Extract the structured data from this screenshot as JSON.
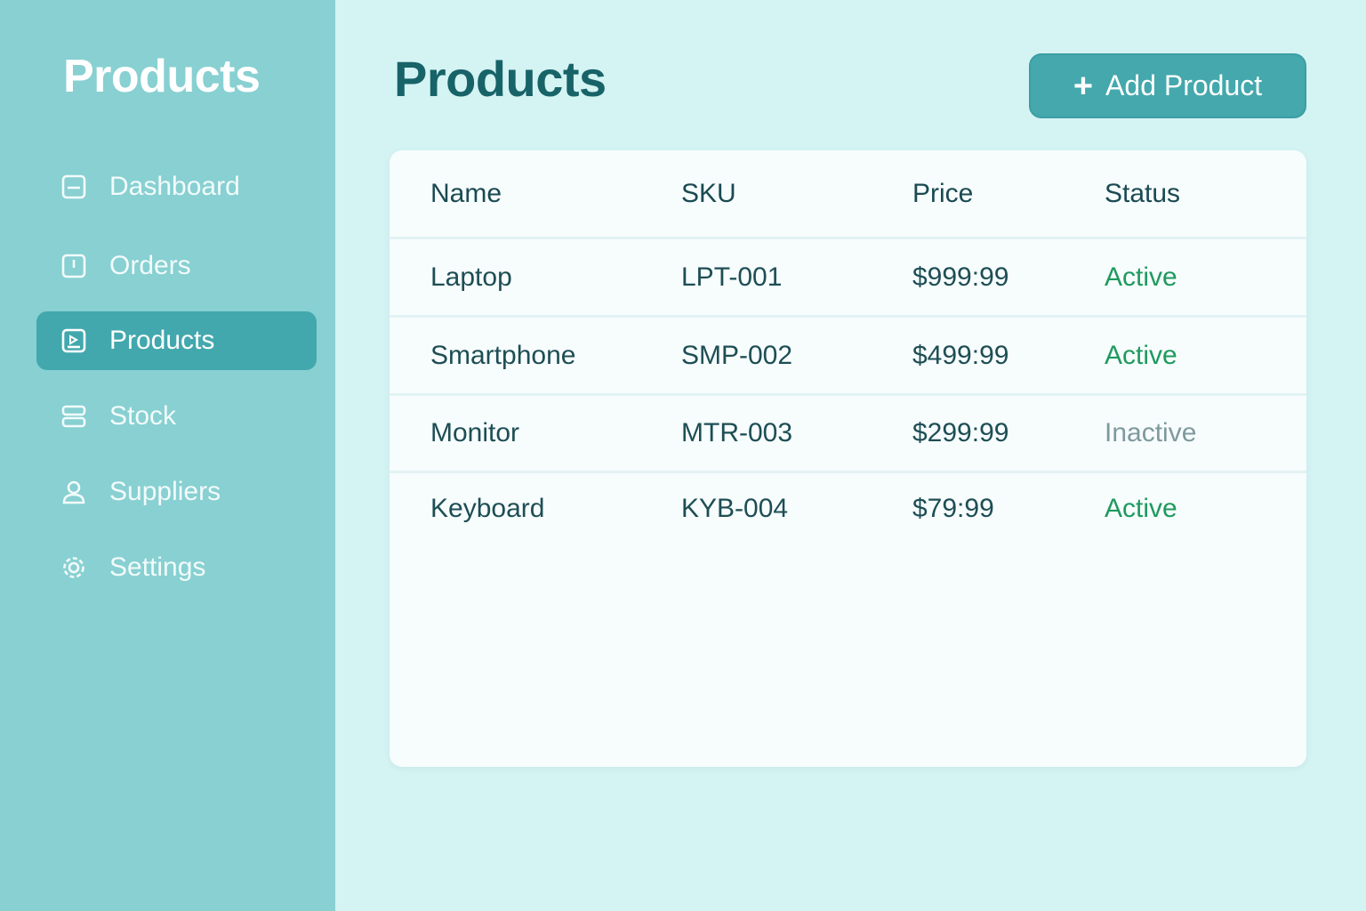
{
  "sidebar": {
    "brand": "Products",
    "items": [
      {
        "label": "Dashboard",
        "icon": "dashboard-icon",
        "active": false
      },
      {
        "label": "Orders",
        "icon": "orders-icon",
        "active": false
      },
      {
        "label": "Products",
        "icon": "products-icon",
        "active": true
      },
      {
        "label": "Stock",
        "icon": "stock-icon",
        "active": false
      },
      {
        "label": "Suppliers",
        "icon": "user-icon",
        "active": false
      },
      {
        "label": "Settings",
        "icon": "gear-icon",
        "active": false
      }
    ]
  },
  "header": {
    "title": "Products",
    "add_button": {
      "icon": "plus-icon",
      "label": "Add Product"
    }
  },
  "table": {
    "columns": [
      "Name",
      "SKU",
      "Price",
      "Status"
    ],
    "rows": [
      {
        "name": "Laptop",
        "sku": "LPT-001",
        "price": "$999:99",
        "status": "Active"
      },
      {
        "name": "Smartphone",
        "sku": "SMP-002",
        "price": "$499:99",
        "status": "Active"
      },
      {
        "name": "Monitor",
        "sku": "MTR-003",
        "price": "$299:99",
        "status": "Inactive"
      },
      {
        "name": "Keyboard",
        "sku": "KYB-004",
        "price": "$79:99",
        "status": "Active"
      }
    ]
  },
  "colors": {
    "sidebar_bg": "#88d0d2",
    "active_nav": "#42a8ad",
    "page_bg": "#d4f3f3",
    "title": "#176368",
    "status_active": "#1e9a5e",
    "status_inactive": "#7e9a9e"
  }
}
